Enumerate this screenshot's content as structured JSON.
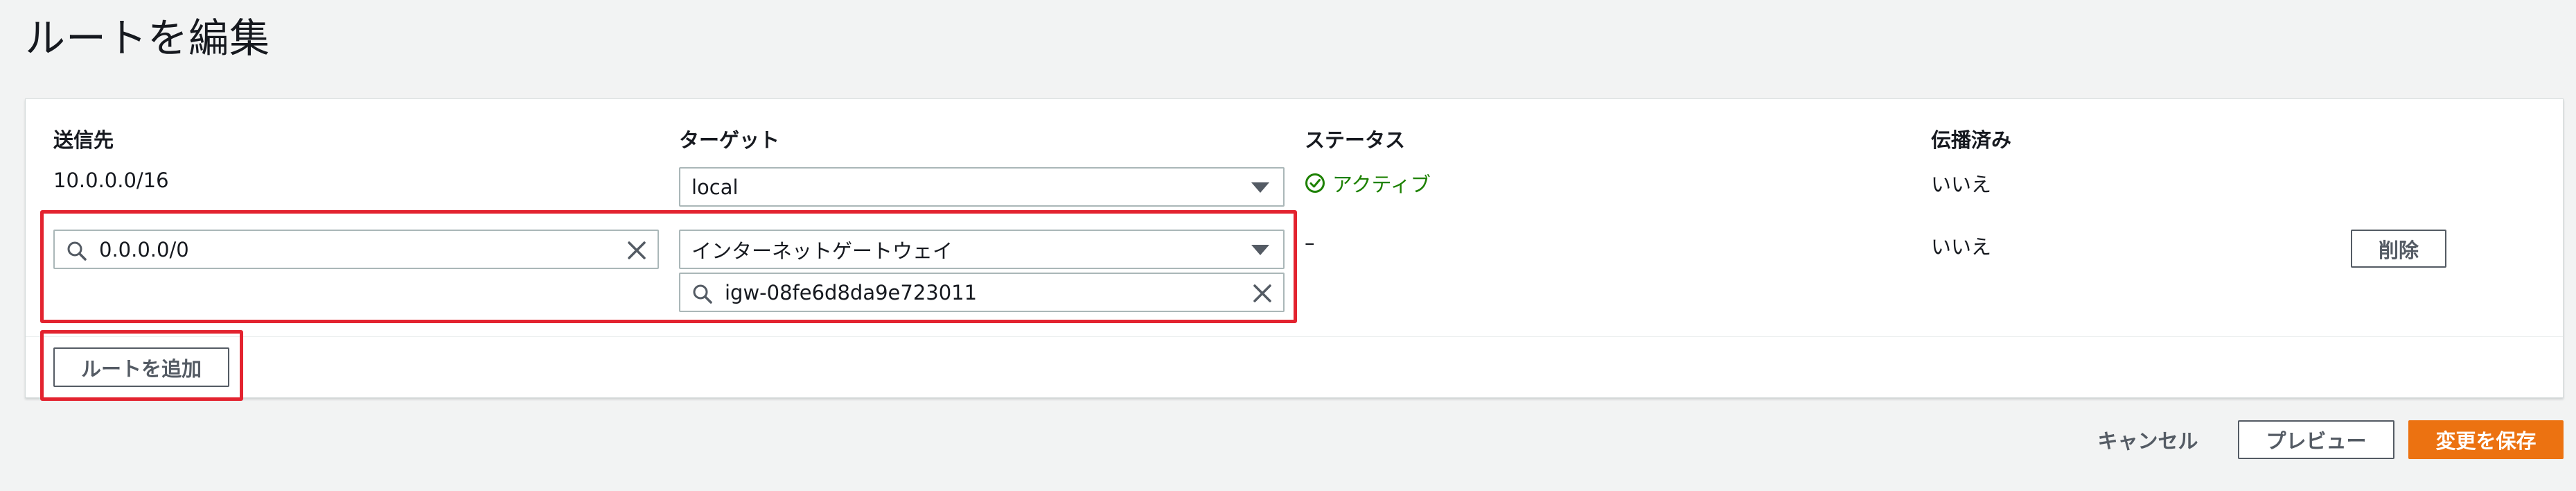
{
  "page": {
    "title": "ルートを編集"
  },
  "table": {
    "headers": {
      "destination": "送信先",
      "target": "ターゲット",
      "status": "ステータス",
      "propagated": "伝播済み"
    },
    "rows": [
      {
        "destination": "10.0.0.0/16",
        "target_select": "local",
        "status": "アクティブ",
        "propagated": "いいえ"
      },
      {
        "destination_input": "0.0.0.0/0",
        "target_select": "インターネットゲートウェイ",
        "target_search": "igw-08fe6d8da9e723011",
        "status": "–",
        "propagated": "いいえ",
        "remove_label": "削除"
      }
    ]
  },
  "actions": {
    "add_route": "ルートを追加",
    "cancel": "キャンセル",
    "preview": "プレビュー",
    "save": "変更を保存"
  },
  "colors": {
    "primary": "#ec7211",
    "status_active": "#1d8102",
    "highlight": "#e3232f"
  }
}
